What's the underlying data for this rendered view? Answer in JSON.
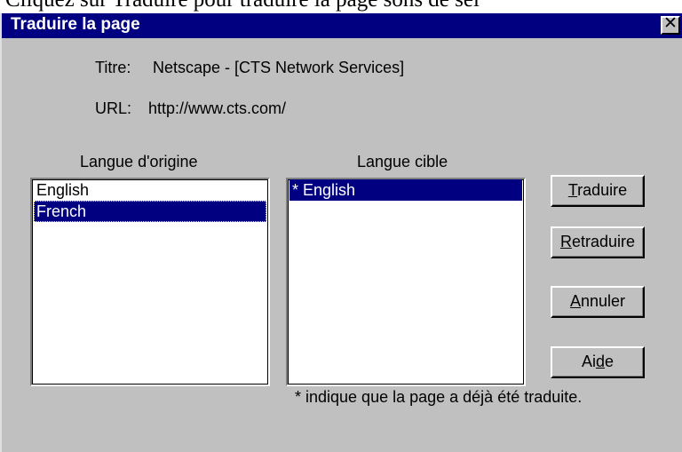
{
  "background_text": "Cliquez sur Traduire pour traduire la page sons de sel",
  "dialog": {
    "title": "Traduire la page",
    "close_glyph": "✕"
  },
  "info": {
    "title_label": "Titre:",
    "title_value": "Netscape - [CTS Network Services]",
    "url_label": "URL:",
    "url_value": "http://www.cts.com/"
  },
  "source": {
    "label": "Langue d'origine",
    "items": [
      {
        "label": "English",
        "selected": false
      },
      {
        "label": "French",
        "selected": true
      }
    ]
  },
  "target": {
    "label": "Langue cible",
    "items": [
      {
        "label": "* English",
        "selected": true
      }
    ]
  },
  "buttons": {
    "translate": {
      "mnemonic": "T",
      "rest": "raduire"
    },
    "retranslate": {
      "mnemonic": "R",
      "rest": "etraduire"
    },
    "cancel": {
      "mnemonic": "A",
      "rest": "nnuler"
    },
    "help": {
      "before": "Ai",
      "mnemonic": "d",
      "rest": "e"
    }
  },
  "note": "* indique que la page a déjà été traduite.",
  "colors": {
    "titlebar": "#000080",
    "dialog_face": "#c0c0c0",
    "selection": "#000080"
  }
}
